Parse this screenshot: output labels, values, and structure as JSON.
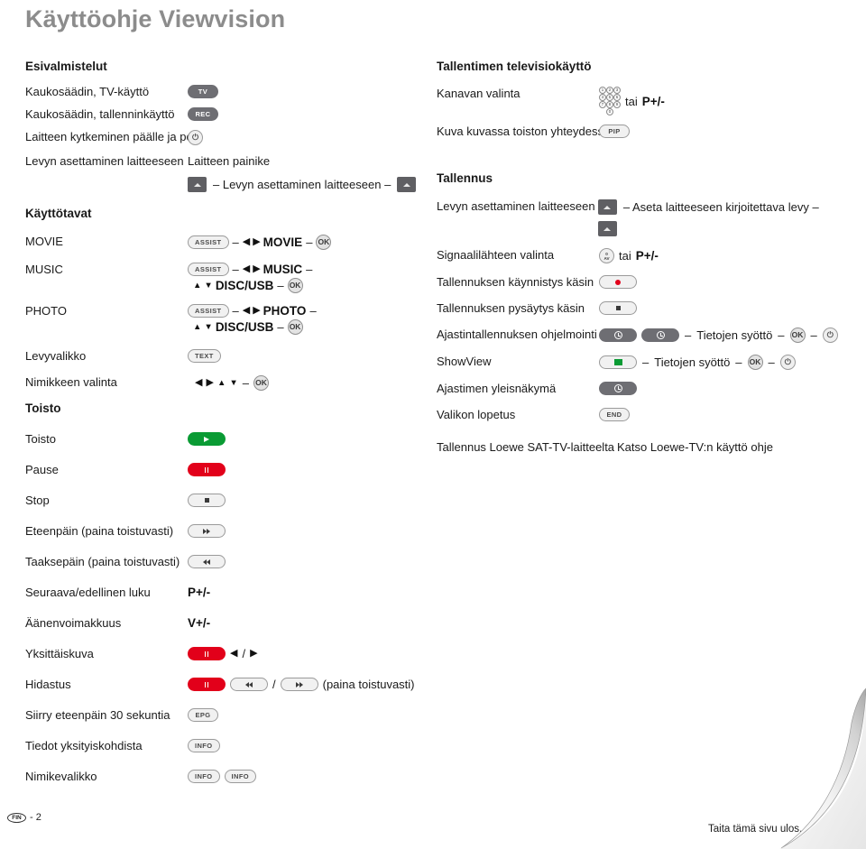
{
  "document": {
    "title": "Käyttöohje Viewvision",
    "footer_page": "- 2",
    "footer_badge": "FIN",
    "footer_note": "Taita tämä sivu ulos."
  },
  "keypad": {
    "keys": [
      "1",
      "2",
      "3",
      "4",
      "5",
      "6",
      "7",
      "8",
      "9",
      "0"
    ]
  },
  "left": {
    "sections": [
      {
        "heading": "Esivalmistelut",
        "rows": [
          {
            "label": "Kaukosäädin, TV-käyttö",
            "controls": [
              {
                "type": "pill-dark",
                "text": "TV"
              }
            ]
          },
          {
            "label": "Kaukosäädin, tallenninkäyttö",
            "controls": [
              {
                "type": "pill-dark",
                "text": "REC"
              }
            ]
          },
          {
            "label": "Laitteen kytkeminen päälle ja pois",
            "controls": [
              {
                "type": "circle-power",
                "text": "⏻"
              }
            ]
          },
          {
            "label": "Levyn asettaminen laitteeseen",
            "controls": [
              {
                "type": "text",
                "text": "Laitteen painike"
              }
            ]
          }
        ],
        "eject_line": {
          "left_button": "eject",
          "text": "– Levyn asettaminen laitteeseen –",
          "right_button": "eject"
        }
      },
      {
        "heading": "Käyttötavat",
        "rows": [
          {
            "label": "MOVIE",
            "sequence": [
              {
                "type": "pill-light",
                "text": "ASSIST"
              },
              {
                "type": "dash",
                "text": "–"
              },
              {
                "type": "arrow",
                "text": "◀"
              },
              {
                "type": "arrow",
                "text": "▶"
              },
              {
                "type": "strong",
                "text": "MOVIE"
              },
              {
                "type": "dash",
                "text": "–"
              },
              {
                "type": "circle-ok",
                "text": "OK"
              }
            ]
          },
          {
            "label": "MUSIC",
            "sequence": [
              {
                "type": "pill-light",
                "text": "ASSIST"
              },
              {
                "type": "dash",
                "text": "–"
              },
              {
                "type": "arrow",
                "text": "◀"
              },
              {
                "type": "arrow",
                "text": "▶"
              },
              {
                "type": "strong",
                "text": "MUSIC"
              },
              {
                "type": "dash",
                "text": "–"
              }
            ],
            "sequence2": [
              {
                "type": "arrow",
                "text": "▲"
              },
              {
                "type": "arrow",
                "text": "▼"
              },
              {
                "type": "strong",
                "text": "DISC/USB"
              },
              {
                "type": "dash",
                "text": "–"
              },
              {
                "type": "circle-ok",
                "text": "OK"
              }
            ]
          },
          {
            "label": "PHOTO",
            "sequence": [
              {
                "type": "pill-light",
                "text": "ASSIST"
              },
              {
                "type": "dash",
                "text": "–"
              },
              {
                "type": "arrow",
                "text": "◀"
              },
              {
                "type": "arrow",
                "text": "▶"
              },
              {
                "type": "strong",
                "text": "PHOTO"
              },
              {
                "type": "dash",
                "text": "–"
              }
            ],
            "sequence2": [
              {
                "type": "arrow",
                "text": "▲"
              },
              {
                "type": "arrow",
                "text": "▼"
              },
              {
                "type": "strong",
                "text": "DISC/USB"
              },
              {
                "type": "dash",
                "text": "–"
              },
              {
                "type": "circle-ok",
                "text": "OK"
              }
            ]
          },
          {
            "label": "Levyvalikko",
            "sequence": [
              {
                "type": "pill-light",
                "text": "TEXT"
              }
            ]
          },
          {
            "label": "Nimikkeen valinta",
            "sequence": [
              {
                "type": "arrow",
                "text": "◀"
              },
              {
                "type": "arrow",
                "text": "▶"
              },
              {
                "type": "arrow",
                "text": "▲"
              },
              {
                "type": "arrow",
                "text": "▼"
              },
              {
                "type": "dash",
                "text": "–"
              },
              {
                "type": "circle-ok",
                "text": "OK"
              }
            ]
          }
        ]
      },
      {
        "heading": "Toisto",
        "rows": [
          {
            "label": "Toisto",
            "controls": [
              {
                "type": "pill-green-play"
              }
            ]
          },
          {
            "label": "Pause",
            "controls": [
              {
                "type": "pill-red-pause"
              }
            ]
          },
          {
            "label": "Stop",
            "controls": [
              {
                "type": "pill-light-stop"
              }
            ]
          },
          {
            "label": "Eteenpäin (paina toistuvasti)",
            "controls": [
              {
                "type": "pill-light-ff"
              }
            ]
          },
          {
            "label": "Taaksepäin (paina toistuvasti)",
            "controls": [
              {
                "type": "pill-light-rw"
              }
            ]
          },
          {
            "label": "Seuraava/edellinen luku",
            "controls": [
              {
                "type": "strong",
                "text": "P+/-"
              }
            ]
          },
          {
            "label": "Äänenvoimakkuus",
            "controls": [
              {
                "type": "strong",
                "text": "V+/-"
              }
            ]
          },
          {
            "label": "Yksittäiskuva",
            "controls": [
              {
                "type": "pill-red-pause"
              },
              {
                "type": "arrow",
                "text": "◀"
              },
              {
                "type": "plain",
                "text": "/"
              },
              {
                "type": "arrow",
                "text": "▶"
              }
            ]
          },
          {
            "label": "Hidastus",
            "controls": [
              {
                "type": "pill-red-pause"
              },
              {
                "type": "pill-light-rw"
              },
              {
                "type": "plain",
                "text": "/"
              },
              {
                "type": "pill-light-ff"
              },
              {
                "type": "plain",
                "text": "(paina toistuvasti)"
              }
            ]
          },
          {
            "label": "Siirry eteenpäin 30 sekuntia",
            "controls": [
              {
                "type": "pill-light",
                "text": "EPG"
              }
            ]
          },
          {
            "label": "Tiedot yksityiskohdista",
            "controls": [
              {
                "type": "pill-light",
                "text": "INFO"
              }
            ]
          },
          {
            "label": "Nimikevalikko",
            "controls": [
              {
                "type": "pill-light",
                "text": "INFO"
              },
              {
                "type": "pill-light",
                "text": "INFO"
              }
            ]
          }
        ]
      }
    ]
  },
  "right": {
    "sections": [
      {
        "heading": "Tallentimen televisiokäyttö",
        "rows": [
          {
            "label": "Kanavan valinta",
            "controls": [
              {
                "type": "keypad"
              },
              {
                "type": "plain",
                "text": "tai"
              },
              {
                "type": "strong",
                "text": "P+/-"
              }
            ]
          },
          {
            "label": "Kuva kuvassa toiston yhteydessä",
            "controls": [
              {
                "type": "pill-light",
                "text": "PIP"
              }
            ]
          }
        ]
      },
      {
        "heading": "Tallennus",
        "eject_line": {
          "left_button": "eject",
          "label": "Levyn asettaminen laitteeseen",
          "text": "– Aseta laitteeseen kirjoitettava levy –",
          "right_button": "eject"
        },
        "rows": [
          {
            "label": "Signaalilähteen valinta",
            "controls": [
              {
                "type": "circle-av",
                "top": "0",
                "bottom": "AV"
              },
              {
                "type": "plain",
                "text": "tai"
              },
              {
                "type": "strong",
                "text": "P+/-"
              }
            ]
          },
          {
            "label": "Tallennuksen käynnistys käsin",
            "controls": [
              {
                "type": "pill-light-rec"
              }
            ]
          },
          {
            "label": "Tallennuksen pysäytys käsin",
            "controls": [
              {
                "type": "pill-light-stop"
              }
            ]
          },
          {
            "label": "Ajastintallennuksen ohjelmointi",
            "controls": [
              {
                "type": "pill-dark-clock"
              },
              {
                "type": "pill-dark-clock"
              },
              {
                "type": "dash",
                "text": "–"
              },
              {
                "type": "plain",
                "text": "Tietojen syöttö"
              },
              {
                "type": "dash",
                "text": "–"
              },
              {
                "type": "circle-ok",
                "text": "OK"
              },
              {
                "type": "dash",
                "text": "–"
              },
              {
                "type": "circle-power",
                "text": "⏻"
              }
            ]
          },
          {
            "label": "ShowView",
            "controls": [
              {
                "type": "pill-light-green"
              },
              {
                "type": "dash",
                "text": "–"
              },
              {
                "type": "plain",
                "text": "Tietojen syöttö"
              },
              {
                "type": "dash",
                "text": "–"
              },
              {
                "type": "circle-ok",
                "text": "OK"
              },
              {
                "type": "dash",
                "text": "–"
              },
              {
                "type": "circle-power",
                "text": "⏻"
              }
            ]
          },
          {
            "label": "Ajastimen yleisnäkymä",
            "controls": [
              {
                "type": "pill-dark-clock"
              }
            ]
          },
          {
            "label": "Valikon lopetus",
            "controls": [
              {
                "type": "pill-light",
                "text": "END"
              }
            ]
          }
        ],
        "note_left": "Tallennus Loewe SAT-TV-laitteelta",
        "note_right": "Katso Loewe-TV:n käyttö ohje"
      }
    ]
  }
}
